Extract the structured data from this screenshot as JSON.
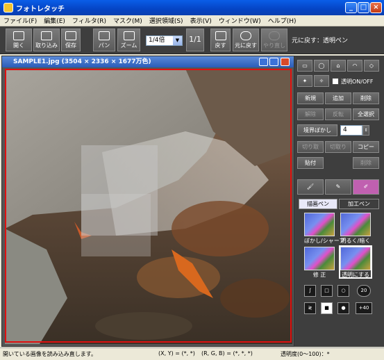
{
  "window": {
    "title": "フォトレタッチ"
  },
  "menu": [
    "ファイル(F)",
    "編集(E)",
    "フィルタ(R)",
    "マスク(M)",
    "選択領域(S)",
    "表示(V)",
    "ウィンドウ(W)",
    "ヘルプ(H)"
  ],
  "toolbar": {
    "open": "開く",
    "import": "取り込み",
    "save": "保存",
    "pan": "パン",
    "zoom": "ズーム",
    "zoom_value": "1/4倍",
    "one_to_one": "1/1",
    "back": "戻す",
    "undo": "元に戻す",
    "redo": "やり直し",
    "undo_status": "元に戻す：透明ペン"
  },
  "image_window": {
    "title": "SAMPLE1.jpg (3504 × 2336 × 1677万色)"
  },
  "selection_panel": {
    "transparent_toggle": "透明ON/OFF",
    "new": "新規",
    "add": "追加",
    "delete": "削除",
    "clear": "解除",
    "invert": "反転",
    "select_all": "全選択",
    "feather": "境界ぼかし",
    "feather_value": "4",
    "cut": "切り取",
    "copy_cut": "切取り",
    "copy": "コピー",
    "paste": "貼付",
    "erase": "削除"
  },
  "pen_panel": {
    "tab_draw": "描画ペン",
    "tab_process": "加工ペン",
    "pens": [
      "ぼかし/シャープ",
      "明るく/暗く",
      "修 正",
      "透明にする"
    ],
    "size_labels": [
      "20",
      "+40"
    ]
  },
  "status": {
    "message": "開いている画像を読み込み直します。",
    "coords": "(X, Y) = (*, *)",
    "rgb": "(R, G, B) = (*, *, *)",
    "transparency": "透明度(0〜100)：*"
  }
}
